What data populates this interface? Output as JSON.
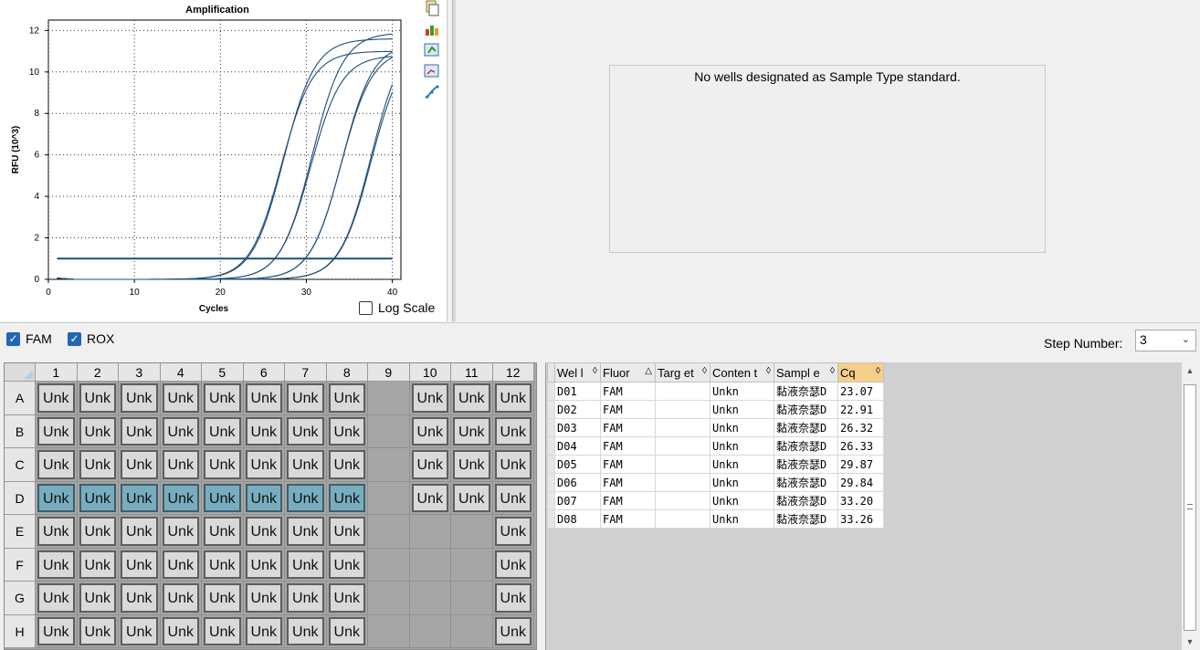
{
  "chart_data": {
    "type": "line",
    "title": "Amplification",
    "xlabel": "Cycles",
    "ylabel": "RFU (10^3)",
    "xlim": [
      0,
      41
    ],
    "ylim": [
      0,
      12.5
    ],
    "xticks": [
      0,
      10,
      20,
      30,
      40
    ],
    "yticks": [
      0,
      2,
      4,
      6,
      8,
      10,
      12
    ],
    "grid": true,
    "threshold": 1.0,
    "cycles_range": [
      1,
      40
    ],
    "series": [
      {
        "well": "D01",
        "cq": 23.07,
        "plateau": 11.6
      },
      {
        "well": "D02",
        "cq": 22.91,
        "plateau": 11.0
      },
      {
        "well": "D03",
        "cq": 26.32,
        "plateau": 11.9
      },
      {
        "well": "D04",
        "cq": 26.33,
        "plateau": 10.8
      },
      {
        "well": "D05",
        "cq": 29.87,
        "plateau": 11.4
      },
      {
        "well": "D06",
        "cq": 29.84,
        "plateau": 11.1
      },
      {
        "well": "D07",
        "cq": 33.2,
        "plateau": 11.8
      },
      {
        "well": "D08",
        "cq": 33.26,
        "plateau": 11.3
      }
    ],
    "line_color": "#1f4e79"
  },
  "chart_panel": {
    "log_scale_label": "Log Scale",
    "log_scale_checked": false,
    "tools": [
      "copy-icon",
      "export-chart-icon",
      "refresh-chart-icon",
      "zoom-chart-icon",
      "curve-settings-icon"
    ]
  },
  "standard_panel": {
    "message": "No wells designated as Sample Type standard."
  },
  "filters": {
    "fam_label": "FAM",
    "rox_label": "ROX",
    "fam_checked": true,
    "rox_checked": true,
    "step_label": "Step Number:",
    "step_value": "3"
  },
  "plate": {
    "columns": [
      "1",
      "2",
      "3",
      "4",
      "5",
      "6",
      "7",
      "8",
      "9",
      "10",
      "11",
      "12"
    ],
    "rows": [
      "A",
      "B",
      "C",
      "D",
      "E",
      "F",
      "G",
      "H"
    ],
    "well_label": "Unk",
    "occupied": [
      [
        1,
        1,
        1,
        1,
        1,
        1,
        1,
        1,
        0,
        1,
        1,
        1
      ],
      [
        1,
        1,
        1,
        1,
        1,
        1,
        1,
        1,
        0,
        1,
        1,
        1
      ],
      [
        1,
        1,
        1,
        1,
        1,
        1,
        1,
        1,
        0,
        1,
        1,
        1
      ],
      [
        1,
        1,
        1,
        1,
        1,
        1,
        1,
        1,
        0,
        1,
        1,
        1
      ],
      [
        1,
        1,
        1,
        1,
        1,
        1,
        1,
        1,
        0,
        0,
        0,
        1
      ],
      [
        1,
        1,
        1,
        1,
        1,
        1,
        1,
        1,
        0,
        0,
        0,
        1
      ],
      [
        1,
        1,
        1,
        1,
        1,
        1,
        1,
        1,
        0,
        0,
        0,
        1
      ],
      [
        1,
        1,
        1,
        1,
        1,
        1,
        1,
        1,
        0,
        0,
        0,
        1
      ]
    ],
    "selected_row": "D",
    "selected_cols": [
      1,
      2,
      3,
      4,
      5,
      6,
      7,
      8
    ],
    "selected_color": "#77adbf"
  },
  "results_table": {
    "headers": [
      "Wel l",
      "Fluor",
      "Targ et",
      "Conten t",
      "Sampl e",
      "Cq"
    ],
    "sorted_column": "Cq",
    "rows": [
      {
        "well": "D01",
        "fluor": "FAM",
        "target": "",
        "content": "Unkn",
        "sample": "黏液奈瑟D",
        "cq": "23.07"
      },
      {
        "well": "D02",
        "fluor": "FAM",
        "target": "",
        "content": "Unkn",
        "sample": "黏液奈瑟D",
        "cq": "22.91"
      },
      {
        "well": "D03",
        "fluor": "FAM",
        "target": "",
        "content": "Unkn",
        "sample": "黏液奈瑟D",
        "cq": "26.32"
      },
      {
        "well": "D04",
        "fluor": "FAM",
        "target": "",
        "content": "Unkn",
        "sample": "黏液奈瑟D",
        "cq": "26.33"
      },
      {
        "well": "D05",
        "fluor": "FAM",
        "target": "",
        "content": "Unkn",
        "sample": "黏液奈瑟D",
        "cq": "29.87"
      },
      {
        "well": "D06",
        "fluor": "FAM",
        "target": "",
        "content": "Unkn",
        "sample": "黏液奈瑟D",
        "cq": "29.84"
      },
      {
        "well": "D07",
        "fluor": "FAM",
        "target": "",
        "content": "Unkn",
        "sample": "黏液奈瑟D",
        "cq": "33.20"
      },
      {
        "well": "D08",
        "fluor": "FAM",
        "target": "",
        "content": "Unkn",
        "sample": "黏液奈瑟D",
        "cq": "33.26"
      }
    ]
  }
}
